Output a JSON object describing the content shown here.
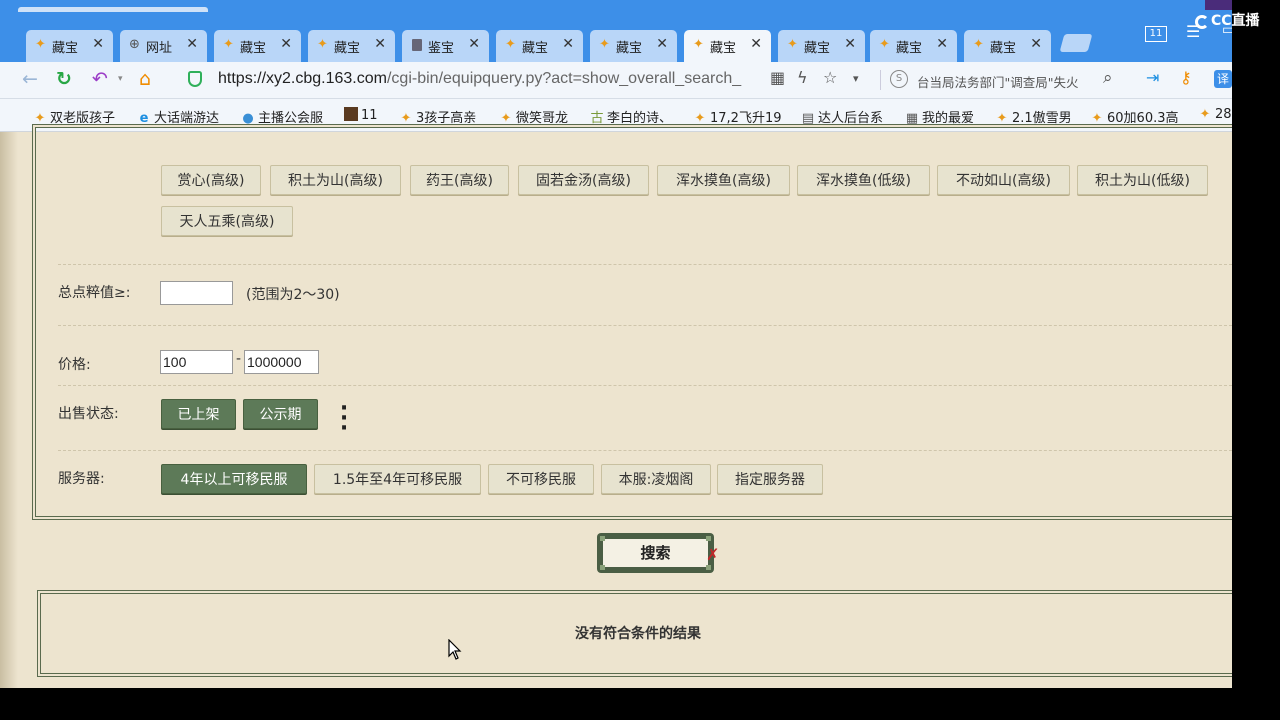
{
  "tabs": [
    {
      "label": "藏宝",
      "icon": "bird-icon",
      "active": false
    },
    {
      "label": "网址",
      "icon": "globe-icon",
      "active": false
    },
    {
      "label": "藏宝",
      "icon": "bird-icon",
      "active": false
    },
    {
      "label": "藏宝",
      "icon": "bird-icon",
      "active": false
    },
    {
      "label": "鉴宝",
      "icon": "document-icon",
      "active": false
    },
    {
      "label": "藏宝",
      "icon": "bird-icon",
      "active": false
    },
    {
      "label": "藏宝",
      "icon": "bird-icon",
      "active": false
    },
    {
      "label": "藏宝",
      "icon": "bird-icon",
      "active": true
    },
    {
      "label": "藏宝",
      "icon": "bird-icon",
      "active": false
    },
    {
      "label": "藏宝",
      "icon": "bird-icon",
      "active": false
    },
    {
      "label": "藏宝",
      "icon": "bird-icon",
      "active": false
    }
  ],
  "window": {
    "tab_count": "11"
  },
  "address": {
    "url_host": "https://xy2.cbg.163.com",
    "url_path": "/cgi-bin/equipquery.py?act=show_overall_search_",
    "search_text": "台当局法务部门\"调查局\"失火"
  },
  "bookmarks": [
    {
      "label": "双老版孩子",
      "icon": "bird-icon"
    },
    {
      "label": "大话端游达",
      "icon": "edge-icon"
    },
    {
      "label": "主播公会服",
      "icon": "live-icon"
    },
    {
      "label": "11",
      "icon": "game-icon"
    },
    {
      "label": "3孩子高亲",
      "icon": "bird-icon"
    },
    {
      "label": "微笑哥龙",
      "icon": "bird-icon"
    },
    {
      "label": "李白的诗、",
      "icon": "gu-icon"
    },
    {
      "label": "17,2飞升19",
      "icon": "bird-icon"
    },
    {
      "label": "达人后台系",
      "icon": "page-icon"
    },
    {
      "label": "我的最爱",
      "icon": "grid-icon"
    },
    {
      "label": "2.1傲雪男",
      "icon": "bird-icon"
    },
    {
      "label": "60加60.3高",
      "icon": "bird-icon"
    },
    {
      "label": "28",
      "icon": "bird-icon"
    }
  ],
  "skills": {
    "row1": [
      "赏心(高级)",
      "积土为山(高级)",
      "药王(高级)",
      "固若金汤(高级)",
      "浑水摸鱼(高级)",
      "浑水摸鱼(低级)",
      "不动如山(高级)",
      "积土为山(低级)"
    ],
    "row2": [
      "天人五乘(高级)"
    ]
  },
  "points": {
    "label": "总点粹值≥:",
    "value": "",
    "hint": "(范围为2～30)"
  },
  "price": {
    "label": "价格:",
    "min": "100",
    "separator": "-",
    "max": "1000000"
  },
  "sale_status": {
    "label": "出售状态:",
    "options": [
      {
        "label": "已上架",
        "active": true
      },
      {
        "label": "公示期",
        "active": true
      }
    ]
  },
  "server": {
    "label": "服务器:",
    "options": [
      {
        "label": "4年以上可移民服",
        "active": true
      },
      {
        "label": "1.5年至4年可移民服",
        "active": false
      },
      {
        "label": "不可移民服",
        "active": false
      },
      {
        "label": "本服:凌烟阁",
        "active": false
      },
      {
        "label": "指定服务器",
        "active": false
      }
    ]
  },
  "search_button": "搜索",
  "no_result": "没有符合条件的结果",
  "watermark": "CC直播"
}
